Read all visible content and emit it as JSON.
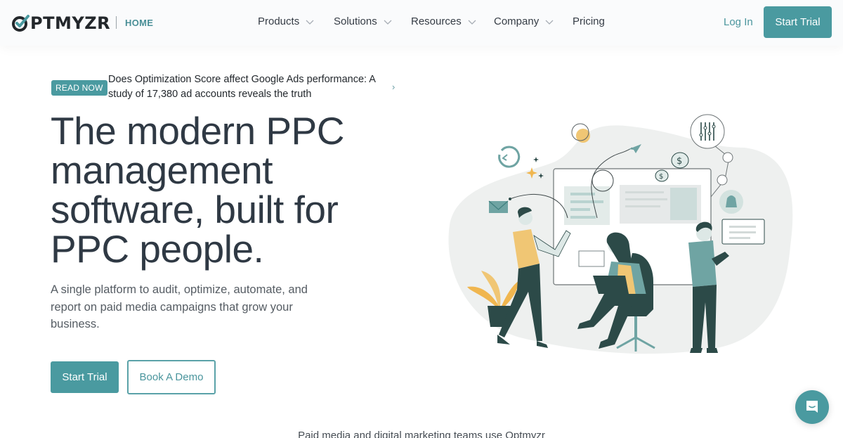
{
  "header": {
    "logo_text": "PTMYZR",
    "logo_full": "OPTMYZR",
    "home_label": "HOME",
    "nav": [
      {
        "label": "Products",
        "has_dropdown": true
      },
      {
        "label": "Solutions",
        "has_dropdown": true
      },
      {
        "label": "Resources",
        "has_dropdown": true
      },
      {
        "label": "Company",
        "has_dropdown": true
      },
      {
        "label": "Pricing",
        "has_dropdown": false
      }
    ],
    "login_label": "Log In",
    "trial_label": "Start Trial"
  },
  "announcement": {
    "badge": "READ NOW",
    "text": "Does Optimization Score affect Google Ads performance: A study of 17,380 ad accounts reveals the truth",
    "icon": "chevron-right-icon"
  },
  "hero": {
    "title": "The modern PPC management software, built for PPC people.",
    "subtitle": "A single platform to audit, optimize, automate, and report on paid media campaigns that grow your business.",
    "primary_cta": "Start Trial",
    "secondary_cta": "Book A Demo"
  },
  "social_proof": {
    "text": "Paid media and digital marketing teams use Optmyzr"
  },
  "chat": {
    "icon": "chat-bubble-icon"
  },
  "colors": {
    "brand_teal": "#4a9aa0",
    "text_dark": "#2f3944",
    "accent_yellow": "#f0b64f",
    "illustration_dark": "#2c4a48",
    "illustration_teal": "#6fa4a3"
  }
}
